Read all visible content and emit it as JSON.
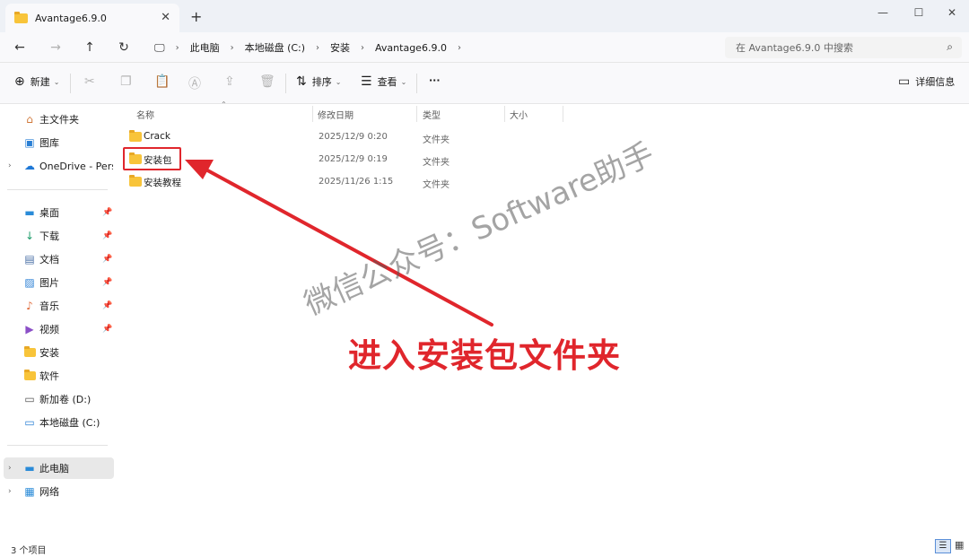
{
  "window": {
    "tab_title": "Avantage6.9.0",
    "new_tab": "+",
    "close_tab": "✕"
  },
  "address": {
    "crumbs": [
      "此电脑",
      "本地磁盘 (C:)",
      "安装",
      "Avantage6.9.0"
    ],
    "search_placeholder": "在 Avantage6.9.0 中搜索"
  },
  "toolbar": {
    "new_label": "新建",
    "sort_label": "排序",
    "view_label": "查看",
    "more_label": "···",
    "details_label": "详细信息"
  },
  "sidebar": {
    "items": [
      {
        "label": "主文件夹"
      },
      {
        "label": "图库"
      },
      {
        "label": "OneDrive - Perso"
      },
      {
        "label": "桌面"
      },
      {
        "label": "下载"
      },
      {
        "label": "文档"
      },
      {
        "label": "图片"
      },
      {
        "label": "音乐"
      },
      {
        "label": "视频"
      },
      {
        "label": "安装"
      },
      {
        "label": "软件"
      },
      {
        "label": "新加卷 (D:)"
      },
      {
        "label": "本地磁盘 (C:)"
      },
      {
        "label": "此电脑"
      },
      {
        "label": "网络"
      }
    ]
  },
  "columns": {
    "name": "名称",
    "modified": "修改日期",
    "type": "类型",
    "size": "大小"
  },
  "files": [
    {
      "name": "Crack",
      "modified": "2025/12/9 0:20",
      "type": "文件夹"
    },
    {
      "name": "安装包",
      "modified": "2025/12/9 0:19",
      "type": "文件夹"
    },
    {
      "name": "安装教程",
      "modified": "2025/11/26 1:15",
      "type": "文件夹"
    }
  ],
  "status": {
    "item_count": "3 个项目"
  },
  "annotation": {
    "text": "进入安装包文件夹",
    "watermark": "微信公众号：Software助手",
    "color": "#e0262c"
  }
}
